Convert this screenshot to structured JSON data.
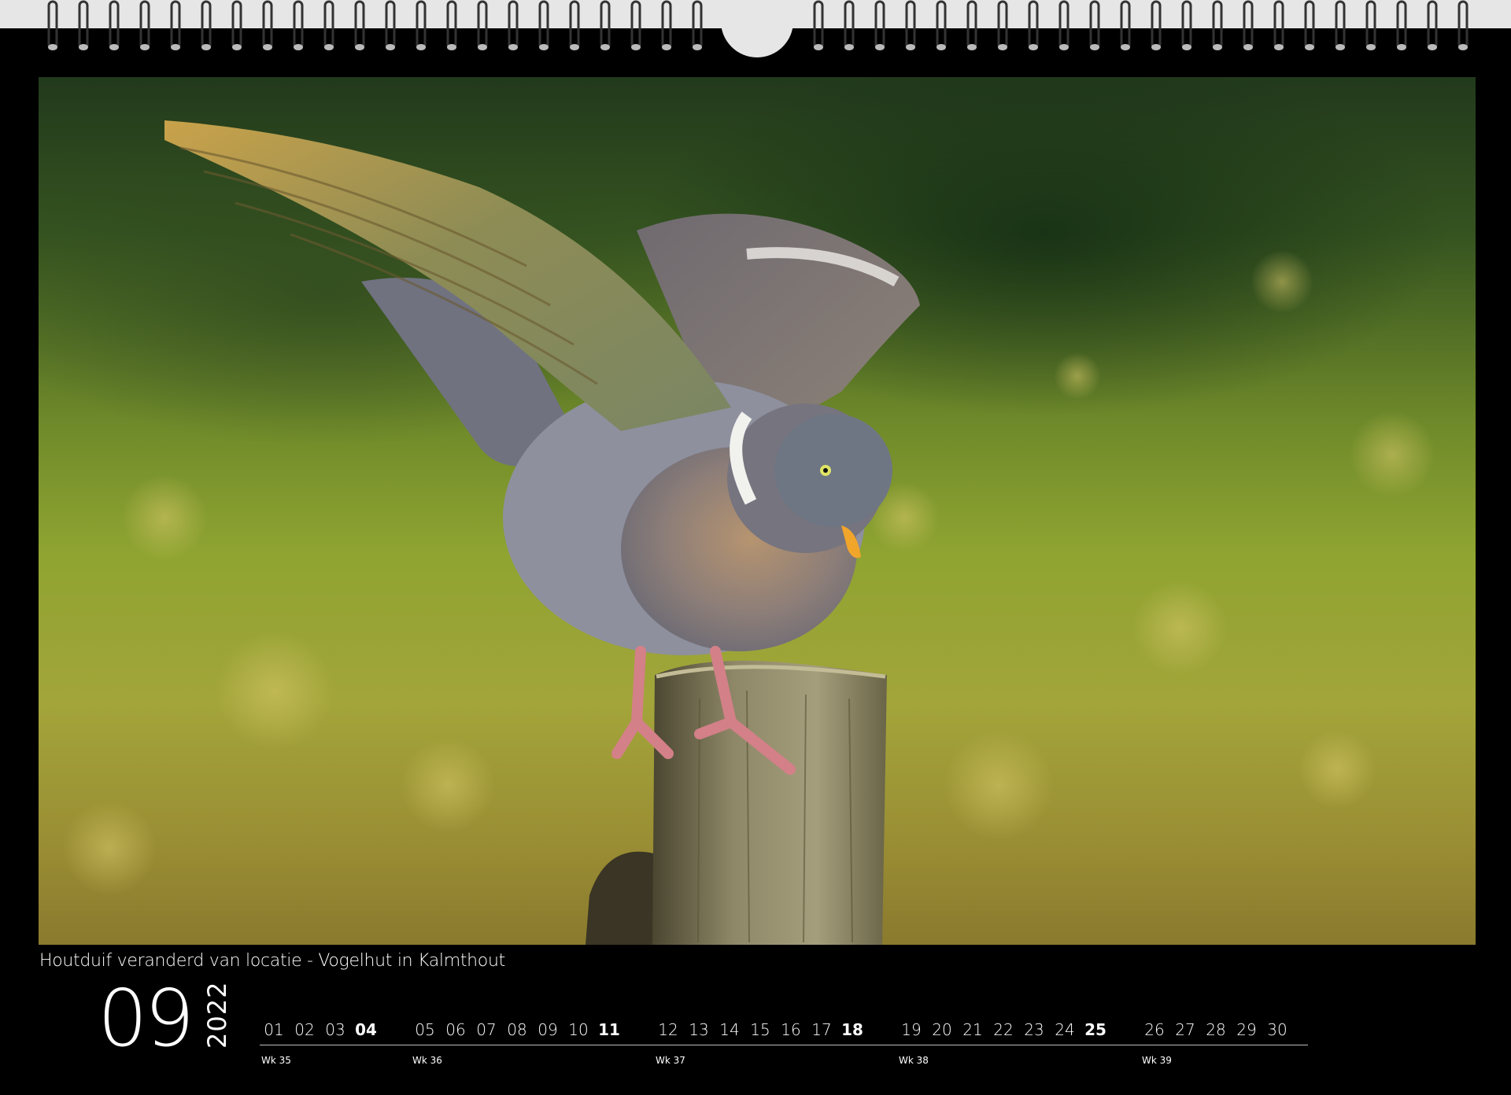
{
  "caption": "Houtduif veranderd van locatie  - Vogelhut in Kalmthout",
  "calendar": {
    "month": "09",
    "year": "2022",
    "days": [
      {
        "label": "01",
        "bold": false
      },
      {
        "label": "02",
        "bold": false
      },
      {
        "label": "03",
        "bold": false
      },
      {
        "label": "04",
        "bold": true
      },
      {
        "label": "05",
        "bold": false
      },
      {
        "label": "06",
        "bold": false
      },
      {
        "label": "07",
        "bold": false
      },
      {
        "label": "08",
        "bold": false
      },
      {
        "label": "09",
        "bold": false
      },
      {
        "label": "10",
        "bold": false
      },
      {
        "label": "11",
        "bold": true
      },
      {
        "label": "12",
        "bold": false
      },
      {
        "label": "13",
        "bold": false
      },
      {
        "label": "14",
        "bold": false
      },
      {
        "label": "15",
        "bold": false
      },
      {
        "label": "16",
        "bold": false
      },
      {
        "label": "17",
        "bold": false
      },
      {
        "label": "18",
        "bold": true
      },
      {
        "label": "19",
        "bold": false
      },
      {
        "label": "20",
        "bold": false
      },
      {
        "label": "21",
        "bold": false
      },
      {
        "label": "22",
        "bold": false
      },
      {
        "label": "23",
        "bold": false
      },
      {
        "label": "24",
        "bold": false
      },
      {
        "label": "25",
        "bold": true
      },
      {
        "label": "26",
        "bold": false
      },
      {
        "label": "27",
        "bold": false
      },
      {
        "label": "28",
        "bold": false
      },
      {
        "label": "29",
        "bold": false
      },
      {
        "label": "30",
        "bold": false
      }
    ],
    "weeks": [
      "Wk 35",
      "Wk 36",
      "Wk 37",
      "Wk 38",
      "Wk 39"
    ]
  },
  "colors": {
    "page": "#000000",
    "binding": "#e6e6e6",
    "text": "#ffffff"
  }
}
